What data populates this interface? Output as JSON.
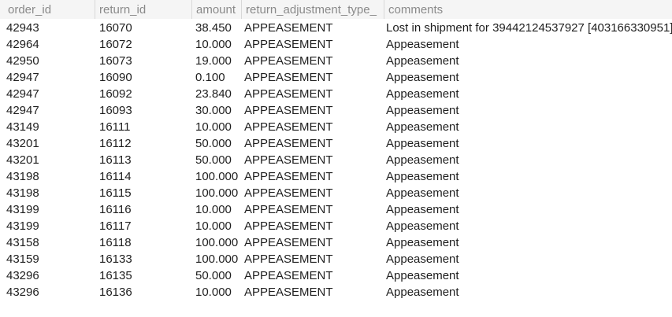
{
  "columns": [
    "order_id",
    "return_id",
    "amount",
    "return_adjustment_type_",
    "comments"
  ],
  "rows": [
    {
      "order_id": "42943",
      "return_id": "16070",
      "amount": "38.450",
      "type": "APPEASEMENT",
      "comments": "Lost in shipment for 39442124537927 [403166330951]"
    },
    {
      "order_id": "42964",
      "return_id": "16072",
      "amount": "10.000",
      "type": "APPEASEMENT",
      "comments": "Appeasement"
    },
    {
      "order_id": "42950",
      "return_id": "16073",
      "amount": "19.000",
      "type": "APPEASEMENT",
      "comments": "Appeasement"
    },
    {
      "order_id": "42947",
      "return_id": "16090",
      "amount": "0.100",
      "type": "APPEASEMENT",
      "comments": "Appeasement"
    },
    {
      "order_id": "42947",
      "return_id": "16092",
      "amount": "23.840",
      "type": "APPEASEMENT",
      "comments": "Appeasement"
    },
    {
      "order_id": "42947",
      "return_id": "16093",
      "amount": "30.000",
      "type": "APPEASEMENT",
      "comments": "Appeasement"
    },
    {
      "order_id": "43149",
      "return_id": "16111",
      "amount": "10.000",
      "type": "APPEASEMENT",
      "comments": "Appeasement"
    },
    {
      "order_id": "43201",
      "return_id": "16112",
      "amount": "50.000",
      "type": "APPEASEMENT",
      "comments": "Appeasement"
    },
    {
      "order_id": "43201",
      "return_id": "16113",
      "amount": "50.000",
      "type": "APPEASEMENT",
      "comments": "Appeasement"
    },
    {
      "order_id": "43198",
      "return_id": "16114",
      "amount": "100.000",
      "type": "APPEASEMENT",
      "comments": "Appeasement"
    },
    {
      "order_id": "43198",
      "return_id": "16115",
      "amount": "100.000",
      "type": "APPEASEMENT",
      "comments": "Appeasement"
    },
    {
      "order_id": "43199",
      "return_id": "16116",
      "amount": "10.000",
      "type": "APPEASEMENT",
      "comments": "Appeasement"
    },
    {
      "order_id": "43199",
      "return_id": "16117",
      "amount": "10.000",
      "type": "APPEASEMENT",
      "comments": "Appeasement"
    },
    {
      "order_id": "43158",
      "return_id": "16118",
      "amount": "100.000",
      "type": "APPEASEMENT",
      "comments": "Appeasement"
    },
    {
      "order_id": "43159",
      "return_id": "16133",
      "amount": "100.000",
      "type": "APPEASEMENT",
      "comments": "Appeasement"
    },
    {
      "order_id": "43296",
      "return_id": "16135",
      "amount": "50.000",
      "type": "APPEASEMENT",
      "comments": "Appeasement"
    },
    {
      "order_id": "43296",
      "return_id": "16136",
      "amount": "10.000",
      "type": "APPEASEMENT",
      "comments": "Appeasement"
    }
  ],
  "colors": {
    "header_bg": "#f5f5f5",
    "header_text": "#8a8a8a",
    "cell_text": "#1e1e1e",
    "background": "#ffffff"
  }
}
